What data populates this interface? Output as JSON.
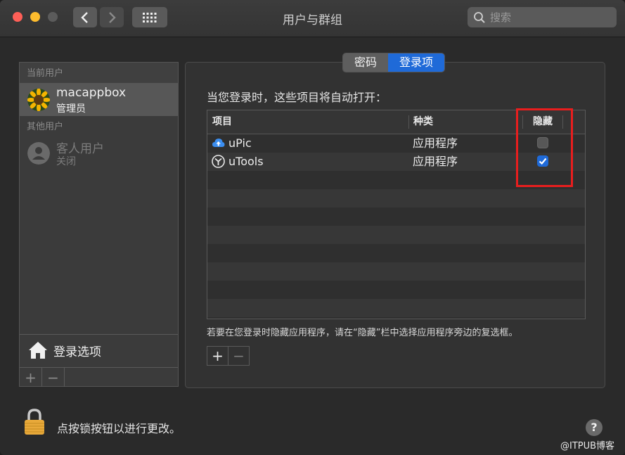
{
  "window": {
    "title": "用户与群组"
  },
  "search": {
    "placeholder": "搜索"
  },
  "sidebar": {
    "current_users_label": "当前用户",
    "current_user": {
      "name": "macappbox",
      "role": "管理员"
    },
    "other_users_label": "其他用户",
    "other_user": {
      "name": "客人用户",
      "status": "关闭"
    },
    "login_options_label": "登录选项",
    "add_symbol": "+",
    "remove_symbol": "−"
  },
  "tabs": [
    {
      "label": "密码",
      "selected": false
    },
    {
      "label": "登录项",
      "selected": true
    }
  ],
  "main": {
    "intro": "当您登录时，这些项目将自动打开：",
    "table": {
      "headers": [
        "项目",
        "种类",
        "隐藏"
      ],
      "rows": [
        {
          "item": "uPic",
          "kind": "应用程序",
          "hidden": false,
          "icon": "upic-cloud-icon"
        },
        {
          "item": "uTools",
          "kind": "应用程序",
          "hidden": true,
          "icon": "utools-icon"
        }
      ]
    },
    "hint": "若要在您登录时隐藏应用程序，请在“隐藏”栏中选择应用程序旁边的复选框。",
    "add_symbol": "+",
    "remove_symbol": "−"
  },
  "footer": {
    "lock_text": "点按锁按钮以进行更改。",
    "help_symbol": "?"
  },
  "watermark": "@ITPUB博客",
  "colors": {
    "accent": "#1f6ad8",
    "highlight_box": "#e81e1e"
  }
}
